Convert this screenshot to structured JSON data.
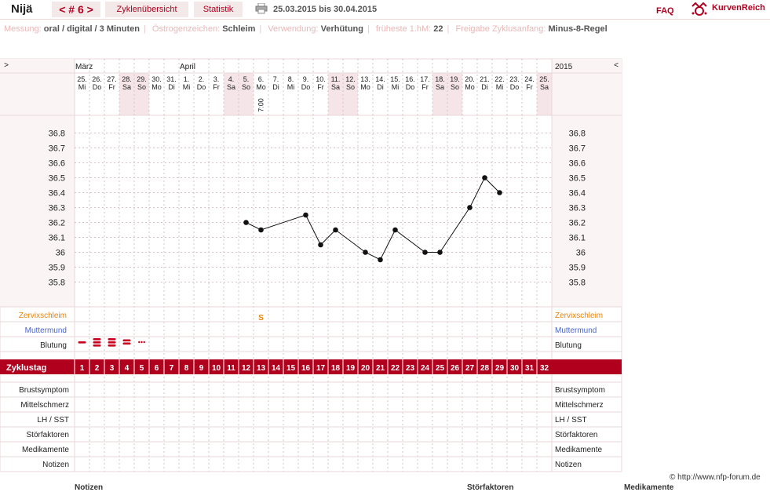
{
  "header": {
    "user": "Nijä",
    "cycle_nav": "< # 6 >",
    "tabs": [
      "Zyklenübersicht",
      "Statistik"
    ],
    "date_range": "25.03.2015 bis 30.04.2015",
    "faq": "FAQ",
    "logo": "KurvenReich"
  },
  "meta": [
    {
      "key": "Messung:",
      "value": "oral / digital / 3 Minuten"
    },
    {
      "key": "Östrogenzeichen:",
      "value": "Schleim"
    },
    {
      "key": "Verwendung:",
      "value": "Verhütung"
    },
    {
      "key": "früheste 1.hM:",
      "value": "22"
    },
    {
      "key": "Freigabe Zyklusanfang:",
      "value": "Minus-8-Regel"
    }
  ],
  "nav": {
    "left": ">",
    "right": "<",
    "year": "2015"
  },
  "colors": {
    "accent": "#b0001e",
    "weekend": "#f5e4e8",
    "border": "#e8d8d8",
    "cervix": "#e8840a",
    "mouth": "#4a64c8"
  },
  "chart_data": {
    "type": "line",
    "months": [
      {
        "label": "März",
        "start": 0
      },
      {
        "label": "April",
        "start": 7
      }
    ],
    "dates": [
      "25.",
      "26.",
      "27.",
      "28.",
      "29.",
      "30.",
      "31.",
      "1.",
      "2.",
      "3.",
      "4.",
      "5.",
      "6.",
      "7.",
      "8.",
      "9.",
      "10.",
      "11.",
      "12.",
      "13.",
      "14.",
      "15.",
      "16.",
      "17.",
      "18.",
      "19.",
      "20.",
      "21.",
      "22.",
      "23.",
      "24.",
      "25."
    ],
    "weekdays": [
      "Mi",
      "Do",
      "Fr",
      "Sa",
      "So",
      "Mo",
      "Di",
      "Mi",
      "Do",
      "Fr",
      "Sa",
      "So",
      "Mo",
      "Di",
      "Mi",
      "Do",
      "Fr",
      "Sa",
      "So",
      "Mo",
      "Di",
      "Mi",
      "Do",
      "Fr",
      "Sa",
      "So",
      "Mo",
      "Di",
      "Mi",
      "Do",
      "Fr",
      "Sa"
    ],
    "weekend": [
      false,
      false,
      false,
      true,
      true,
      false,
      false,
      false,
      false,
      false,
      true,
      true,
      false,
      false,
      false,
      false,
      false,
      true,
      true,
      false,
      false,
      false,
      false,
      false,
      true,
      true,
      false,
      false,
      false,
      false,
      false,
      true
    ],
    "time_label": {
      "day": 13,
      "text": "7:00"
    },
    "ylim": [
      35.75,
      36.85
    ],
    "yticks": [
      36.8,
      36.7,
      36.6,
      36.5,
      36.4,
      36.3,
      36.2,
      36.1,
      36,
      35.9,
      35.8
    ],
    "ytick_labels": [
      "36.8",
      "36.7",
      "36.6",
      "36.5",
      "36.4",
      "36.3",
      "36.2",
      "36.1",
      "36",
      "35.9",
      "35.8"
    ],
    "series": [
      {
        "points": [
          [
            12,
            36.2
          ],
          [
            13,
            36.15
          ],
          [
            16,
            36.25
          ],
          [
            17,
            36.05
          ],
          [
            18,
            36.15
          ],
          [
            20,
            36.0
          ],
          [
            21,
            35.95
          ],
          [
            22,
            36.15
          ],
          [
            24,
            36.0
          ],
          [
            25,
            36.0
          ],
          [
            27,
            36.3
          ],
          [
            28,
            36.5
          ],
          [
            29,
            36.4
          ]
        ]
      }
    ],
    "cervix_label": "Zervixschleim",
    "cervix": [
      {
        "day": 13,
        "symbol": "S"
      }
    ],
    "mouth_label": "Muttermund",
    "bleeding_label": "Blutung",
    "bleeding": [
      {
        "day": 1,
        "level": 1
      },
      {
        "day": 2,
        "level": 3
      },
      {
        "day": 3,
        "level": 3
      },
      {
        "day": 4,
        "level": 2
      },
      {
        "day": 5,
        "level": 0
      }
    ],
    "cycle_day_label": "Zyklustag",
    "cycle_days": [
      "1",
      "2",
      "3",
      "4",
      "5",
      "6",
      "7",
      "8",
      "9",
      "10",
      "11",
      "12",
      "13",
      "14",
      "15",
      "16",
      "17",
      "18",
      "19",
      "20",
      "21",
      "22",
      "23",
      "24",
      "25",
      "26",
      "27",
      "28",
      "29",
      "30",
      "31",
      "32"
    ],
    "extra_rows": [
      "Brustsymptom",
      "Mittelschmerz",
      "LH / SST",
      "Störfaktoren",
      "Medikamente",
      "Notizen"
    ]
  },
  "footer": {
    "credit": "© http://www.nfp-forum.de",
    "below_labels": [
      "Notizen",
      "Störfaktoren",
      "Medikamente"
    ]
  }
}
